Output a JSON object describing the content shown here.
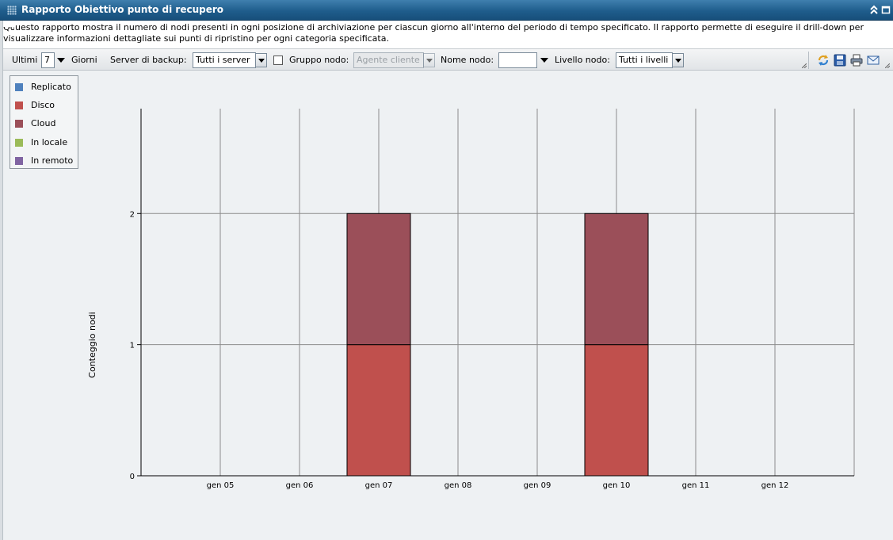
{
  "window": {
    "title": "Rapporto Obiettivo punto di recupero"
  },
  "description": {
    "clipped_prefix_line1": "Qu",
    "clipped_prefix_line2": "vis",
    "text": "uesto rapporto mostra il numero di nodi presenti in ogni posizione di archiviazione per ciascun giorno all'interno del periodo di tempo specificato. Il rapporto permette di eseguire il drill-down per ualizzare informazioni dettagliate sui punti di ripristino per ogni categoria specificata."
  },
  "toolbar": {
    "last_label": "Ultimi",
    "days_value": "7",
    "days_label": "Giorni",
    "backup_server_label": "Server di backup:",
    "backup_server_value": "Tutti i server",
    "node_group_label": "Gruppo nodo:",
    "node_group_value": "Agente cliente",
    "node_group_checked": false,
    "node_name_label": "Nome nodo:",
    "node_name_value": "",
    "node_level_label": "Livello nodo:",
    "node_level_value": "Tutti i livelli",
    "icons": [
      "refresh-icon",
      "save-icon",
      "print-icon",
      "email-icon"
    ]
  },
  "legend": [
    {
      "label": "Replicato",
      "color": "#4f81bd"
    },
    {
      "label": "Disco",
      "color": "#c0504d"
    },
    {
      "label": "Cloud",
      "color": "#9b4f59"
    },
    {
      "label": "In locale",
      "color": "#9bbb59"
    },
    {
      "label": "In remoto",
      "color": "#8064a2"
    }
  ],
  "chart_data": {
    "type": "bar",
    "stacked": true,
    "ylabel": "Conteggio nodi",
    "xlabel": "",
    "title": "",
    "categories": [
      "",
      "gen 05",
      "gen 06",
      "gen 07",
      "gen 08",
      "gen 09",
      "gen 10",
      "gen 11",
      "gen 12"
    ],
    "ylim": [
      0,
      2.8
    ],
    "yticks": [
      0,
      1,
      2
    ],
    "grid": true,
    "series": [
      {
        "name": "Replicato",
        "values": [
          0,
          0,
          0,
          0,
          0,
          0,
          0,
          0,
          0
        ]
      },
      {
        "name": "Disco",
        "values": [
          0,
          0,
          0,
          1,
          0,
          0,
          1,
          0,
          0
        ]
      },
      {
        "name": "Cloud",
        "values": [
          0,
          0,
          0,
          1,
          0,
          0,
          1,
          0,
          0
        ]
      },
      {
        "name": "In locale",
        "values": [
          0,
          0,
          0,
          0,
          0,
          0,
          0,
          0,
          0
        ]
      },
      {
        "name": "In remoto",
        "values": [
          0,
          0,
          0,
          0,
          0,
          0,
          0,
          0,
          0
        ]
      }
    ]
  }
}
